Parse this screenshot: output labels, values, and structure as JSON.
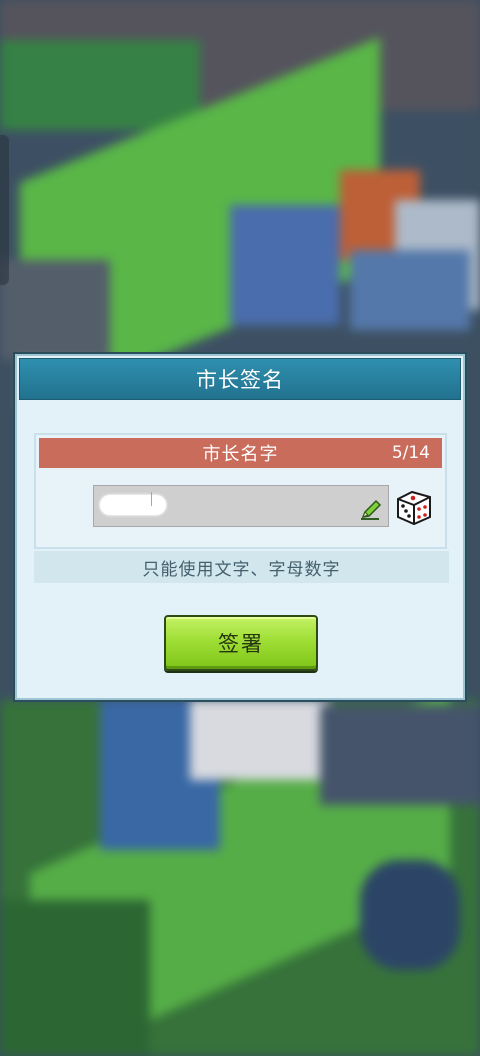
{
  "dialog": {
    "title": "市长签名",
    "name_section": {
      "title": "市长名字",
      "counter": "5/14",
      "input_value": "",
      "random_icon": "dice-icon",
      "edit_icon": "pencil-icon"
    },
    "hint": "只能使用文字、字母数字",
    "confirm_button": "签署"
  },
  "colors": {
    "header": "#2a84a3",
    "name_header": "#c96c5c",
    "button": "#9fde35",
    "dialog_bg": "#e3f1f8"
  }
}
